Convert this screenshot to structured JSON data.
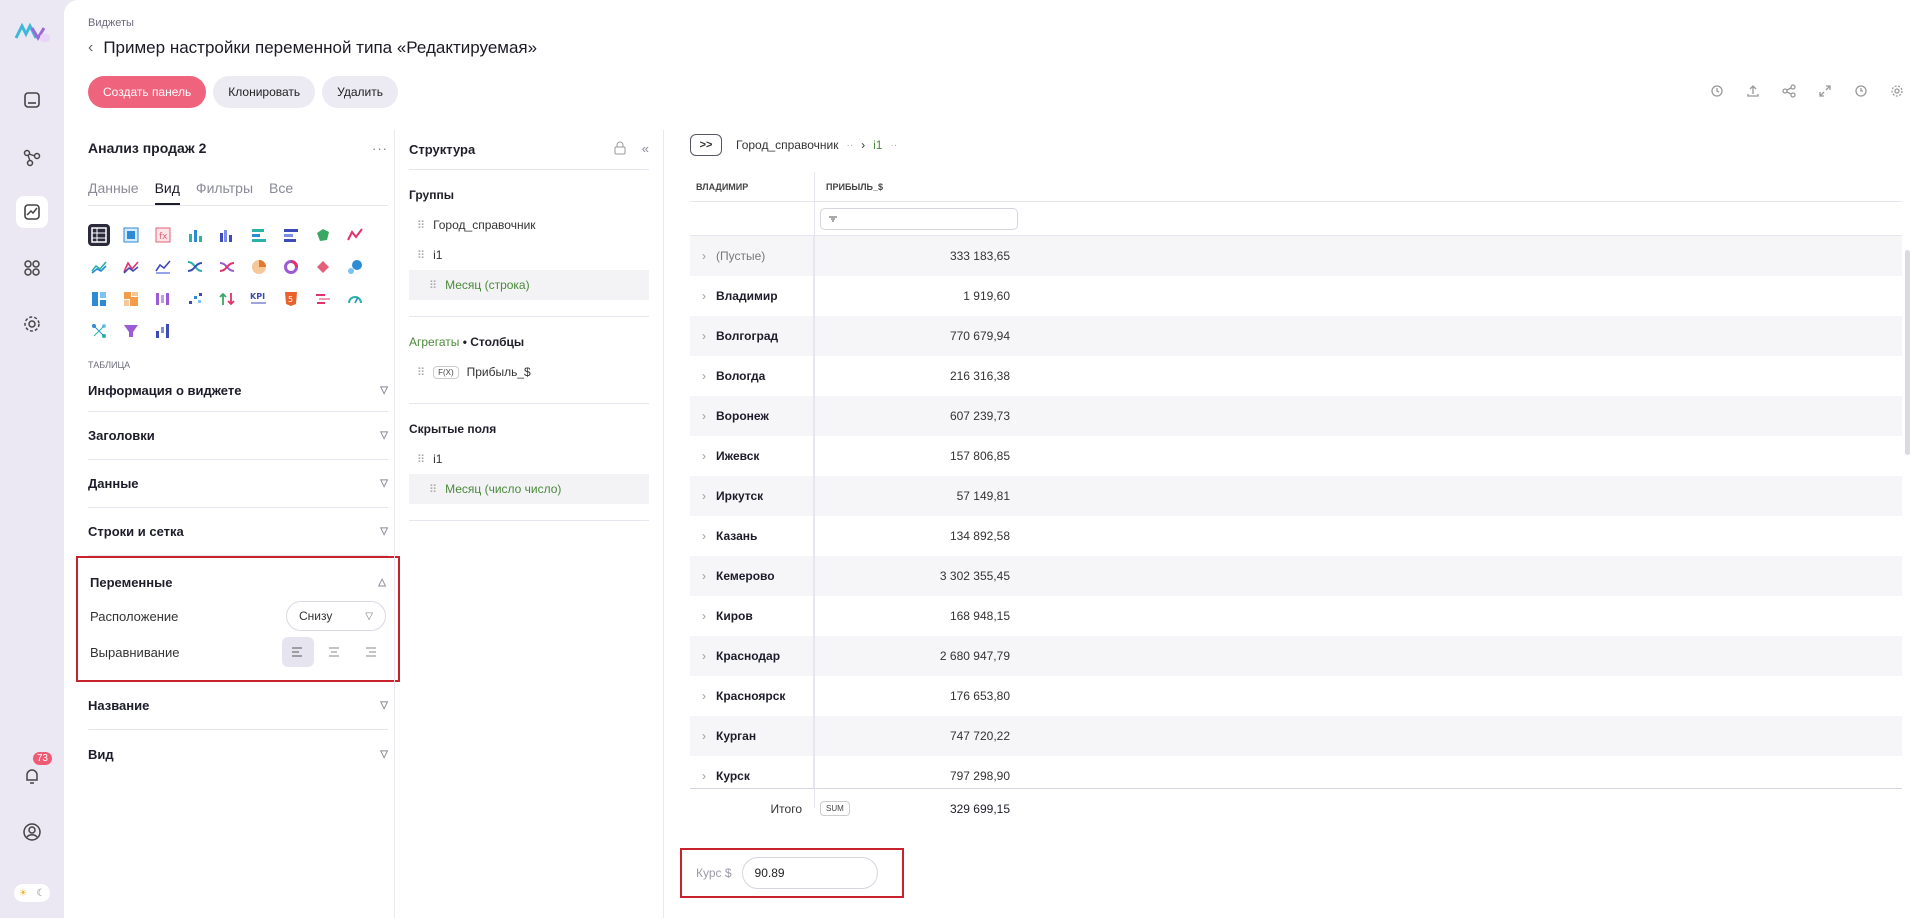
{
  "rail": {
    "notification_count": "73",
    "items": [
      "dashboard-icon",
      "graph-icon",
      "chart-icon",
      "apps-icon",
      "settings-icon"
    ]
  },
  "header": {
    "breadcrumb": "Виджеты",
    "title": "Пример настройки переменной типа «Редактируемая»"
  },
  "actions": {
    "create": "Создать панель",
    "clone": "Клонировать",
    "delete": "Удалить"
  },
  "settings": {
    "widget_title": "Анализ продаж 2",
    "tabs": [
      "Данные",
      "Вид",
      "Фильтры",
      "Все"
    ],
    "active_tab": "Вид",
    "grid_section": "ТАБЛИЦА",
    "sections": {
      "info": "Информация о виджете",
      "headers": "Заголовки",
      "data": "Данные",
      "rows": "Строки и сетка",
      "variables": "Переменные",
      "name": "Название",
      "view": "Вид"
    },
    "variables": {
      "position_label": "Расположение",
      "position_value": "Снизу",
      "align_label": "Выравнивание"
    }
  },
  "structure": {
    "title": "Структура",
    "groups_label": "Группы",
    "groups": [
      "Город_справочник",
      "i1"
    ],
    "groups_sub": "Месяц (строка)",
    "aggregates_label": "Агрегаты",
    "columns_label": "• Столбцы",
    "aggregate_tag": "F(X)",
    "aggregate_field": "Прибыль_$",
    "hidden_label": "Скрытые поля",
    "hidden": [
      "i1"
    ],
    "hidden_sub": "Месяц (число число)"
  },
  "table": {
    "toolbar": {
      "expand": ">>",
      "chip1": "Город_справочник",
      "chip2": "i1"
    },
    "headers": [
      "ВЛАДИМИР",
      "ПРИБЫЛЬ_$"
    ],
    "rows": [
      {
        "city": "(Пустые)",
        "value": "333 183,65"
      },
      {
        "city": "Владимир",
        "value": "1 919,60"
      },
      {
        "city": "Волгоград",
        "value": "770 679,94"
      },
      {
        "city": "Вологда",
        "value": "216 316,38"
      },
      {
        "city": "Воронеж",
        "value": "607 239,73"
      },
      {
        "city": "Ижевск",
        "value": "157 806,85"
      },
      {
        "city": "Иркутск",
        "value": "57 149,81"
      },
      {
        "city": "Казань",
        "value": "134 892,58"
      },
      {
        "city": "Кемерово",
        "value": "3 302 355,45"
      },
      {
        "city": "Киров",
        "value": "168 948,15"
      },
      {
        "city": "Краснодар",
        "value": "2 680 947,79"
      },
      {
        "city": "Красноярск",
        "value": "176 653,80"
      },
      {
        "city": "Курган",
        "value": "747 720,22"
      },
      {
        "city": "Курск",
        "value": "797 298,90"
      }
    ],
    "total_label": "Итого",
    "total_tag": "SUM",
    "total_value": "329 699,15"
  },
  "variable": {
    "label": "Курс $",
    "value": "90.89"
  },
  "colors": {
    "accent": "#f0637d",
    "highlight_border": "#c8232c",
    "green_text": "#4a8a3a"
  }
}
